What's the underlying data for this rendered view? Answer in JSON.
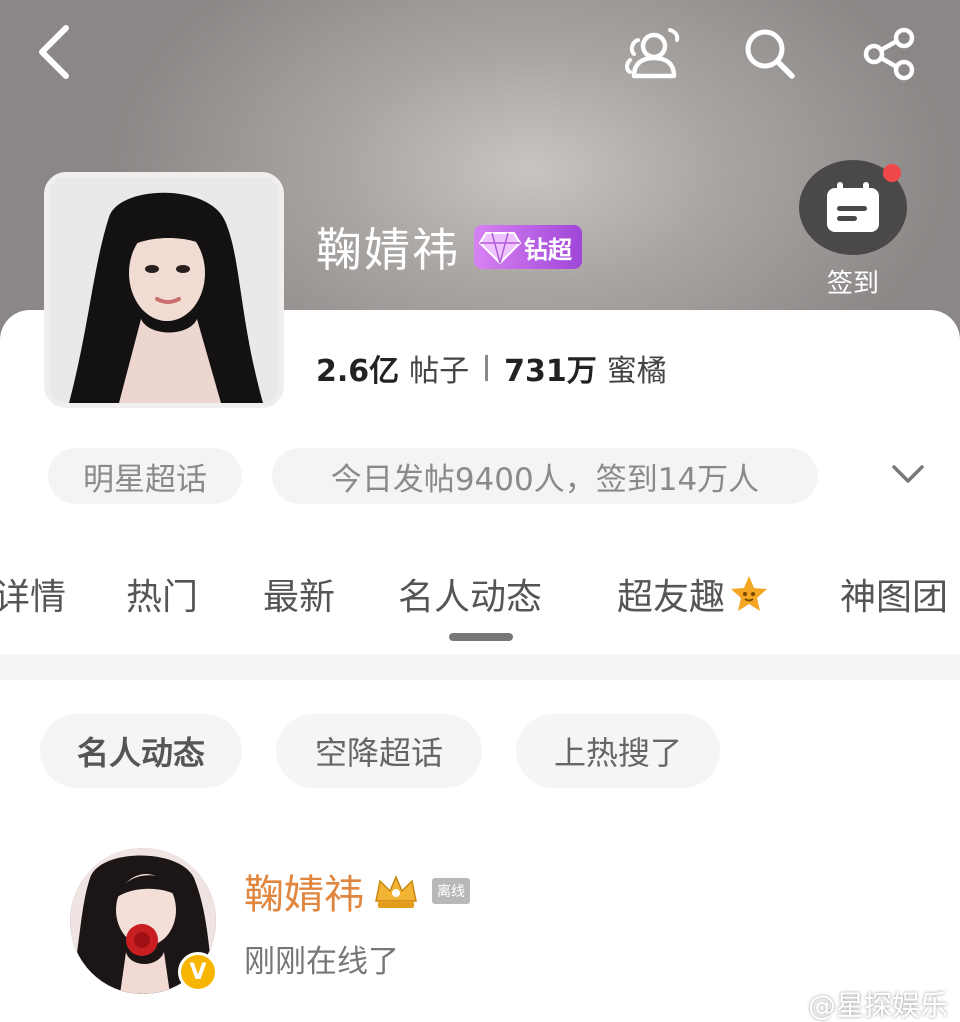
{
  "header": {
    "checkin_label": "签到"
  },
  "topic": {
    "title": "鞠婧祎",
    "badge_text": "钻超",
    "posts_count": "2.6亿",
    "posts_unit": "帖子",
    "fans_count": "731万",
    "fans_unit": "蜜橘",
    "category_chip": "明星超话",
    "daily_stat": "今日发帖9400人，签到14万人"
  },
  "tabs": [
    {
      "label": "详情"
    },
    {
      "label": "热门"
    },
    {
      "label": "最新"
    },
    {
      "label": "名人动态",
      "active": true
    },
    {
      "label": "超友趣"
    },
    {
      "label": "神图团"
    }
  ],
  "filters": [
    {
      "label": "名人动态",
      "active": true
    },
    {
      "label": "空降超话"
    },
    {
      "label": "上热搜了"
    }
  ],
  "post": {
    "author": "鞠婧祎",
    "offline_tag": "离线",
    "status": "刚刚在线了"
  },
  "watermark": "@星探娱乐",
  "colors": {
    "accent_orange": "#e0863e",
    "badge_purple": "#a046d8",
    "notify_red": "#f04848"
  }
}
